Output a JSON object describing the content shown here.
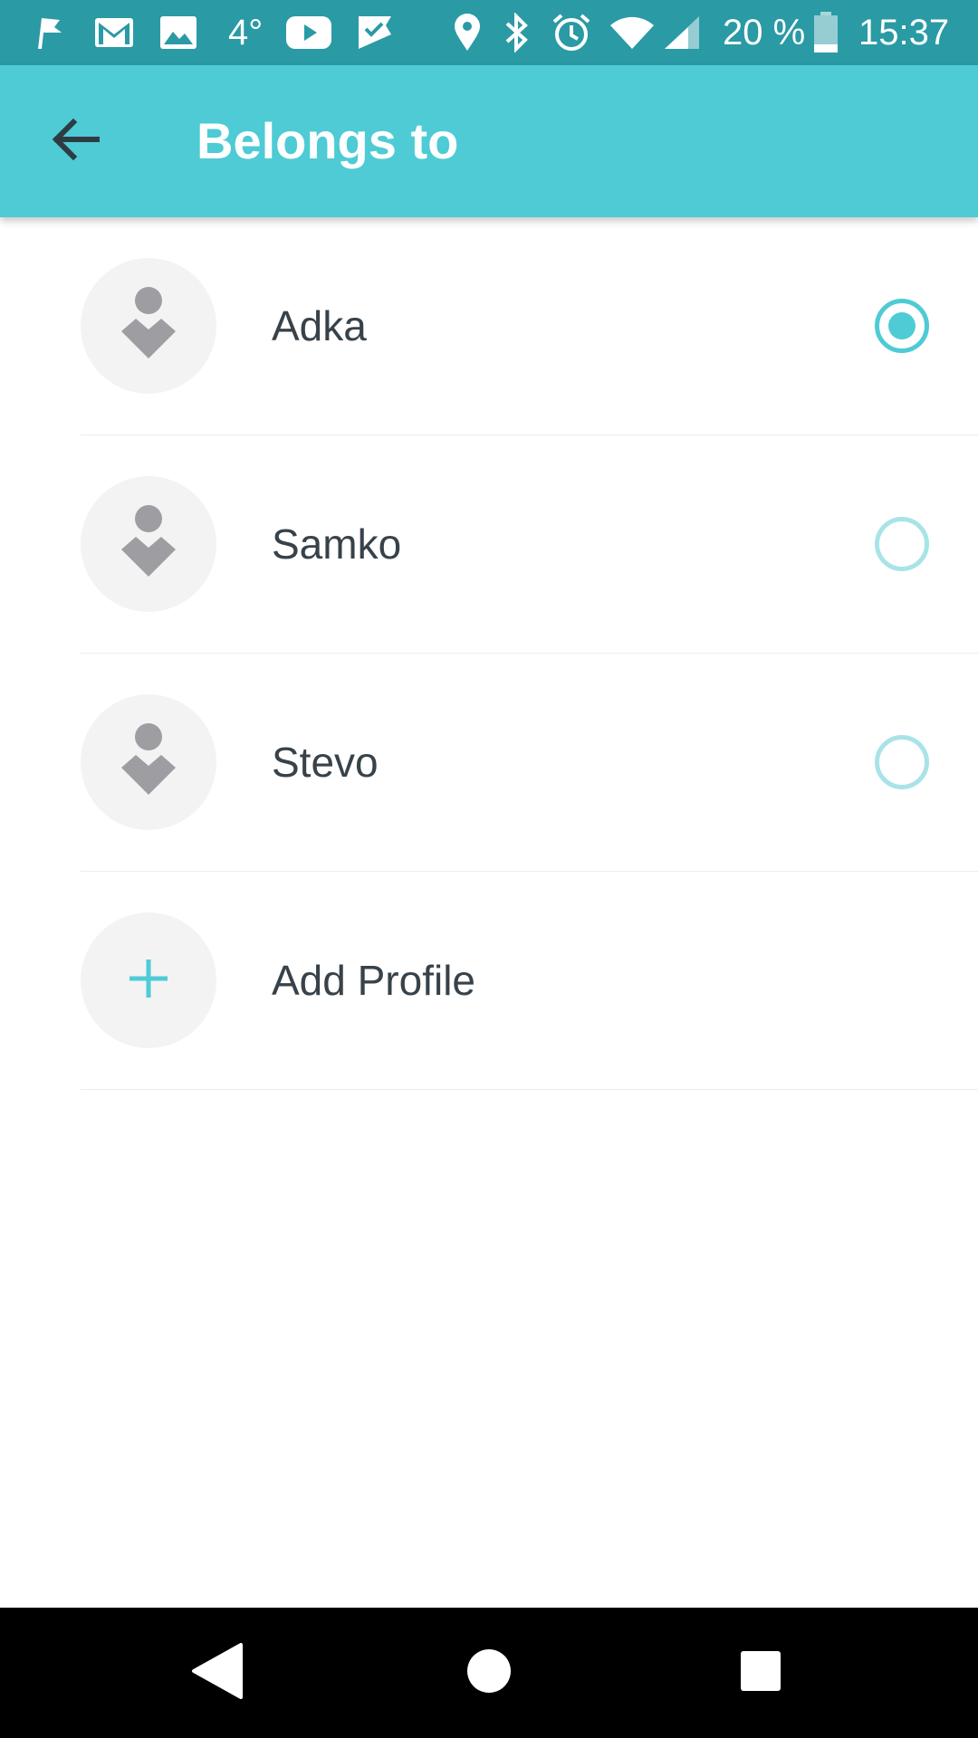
{
  "status_bar": {
    "temperature": "4°",
    "battery_percent": "20 %",
    "time": "15:37",
    "icons": [
      "flag-icon",
      "gmail-icon",
      "gallery-icon",
      "youtube-icon",
      "tasks-icon",
      "location-icon",
      "bluetooth-icon",
      "alarm-icon",
      "wifi-icon",
      "signal-icon",
      "battery-icon"
    ]
  },
  "app_bar": {
    "title": "Belongs to",
    "back_icon": "arrow-back-icon"
  },
  "profiles": [
    {
      "name": "Adka",
      "selected": true
    },
    {
      "name": "Samko",
      "selected": false
    },
    {
      "name": "Stevo",
      "selected": false
    }
  ],
  "add_profile": {
    "label": "Add Profile",
    "icon": "plus-icon"
  },
  "colors": {
    "accent": "#4ecbd5",
    "status_bar": "#2a9aa5",
    "radio_unselected": "#a9e3e8",
    "text": "#37424a",
    "avatar_bg": "#f3f3f3",
    "avatar_icon": "#9e9ea2"
  }
}
